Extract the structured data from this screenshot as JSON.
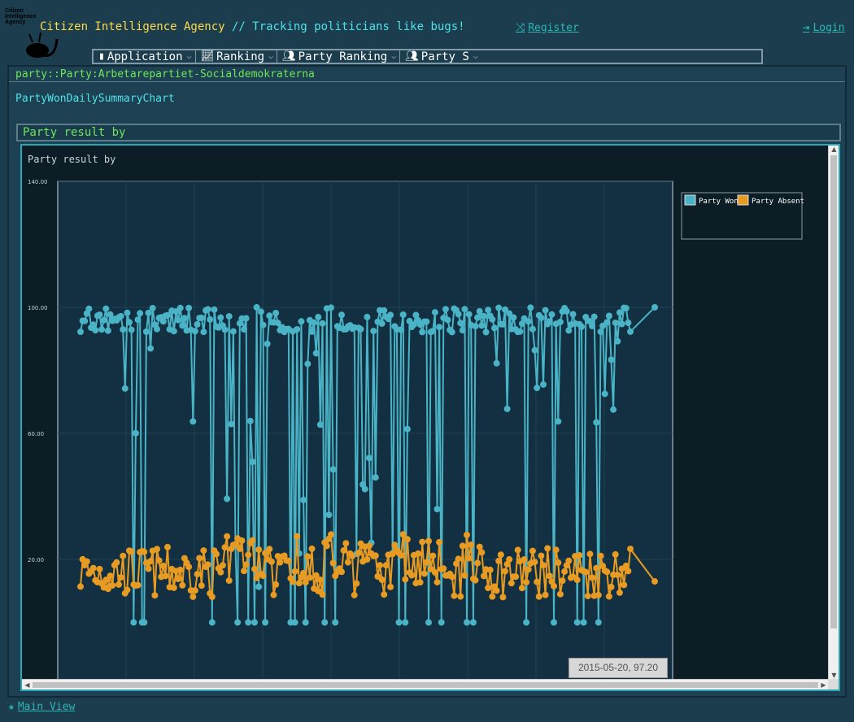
{
  "header": {
    "logo_text": [
      "Citizen",
      "Intelligence",
      "Agency"
    ],
    "title_main": "Citizen Intelligence Agency",
    "title_accent": " // Tracking politicians like bugs!",
    "register_label": "Register",
    "login_label": "Login"
  },
  "menu": {
    "items": [
      {
        "label": "Application",
        "icon": "bottle-icon"
      },
      {
        "label": "Ranking",
        "icon": "line-chart-icon"
      },
      {
        "label": "Party Ranking",
        "icon": "group-icon"
      },
      {
        "label": "Party S",
        "icon": "group-icon"
      }
    ]
  },
  "page": {
    "breadcrumb": "party::Party:Arbetarepartiet-Socialdemokraterna",
    "heading": "PartyWonDailySummaryChart",
    "section_title": "Party result by"
  },
  "chart_data": {
    "type": "line",
    "title": "Party result by",
    "y_ticks": [
      "140.00",
      "100.00",
      "60.00",
      "20.00"
    ],
    "ylim": [
      -20,
      140
    ],
    "x": "daily sessions (dates not labeled)",
    "legend_placement": "top-right",
    "grid": true,
    "series": [
      {
        "name": "Party Won",
        "color": "#4ab3c6",
        "typical_range": [
          0,
          100
        ],
        "upper_level": 100,
        "lower_level": 0
      },
      {
        "name": "Party Absent",
        "color": "#e89b22",
        "typical_range": [
          6,
          28
        ]
      }
    ],
    "tooltip": "2015-05-20, 97.20"
  },
  "footer": {
    "main_view_label": "Main View"
  }
}
